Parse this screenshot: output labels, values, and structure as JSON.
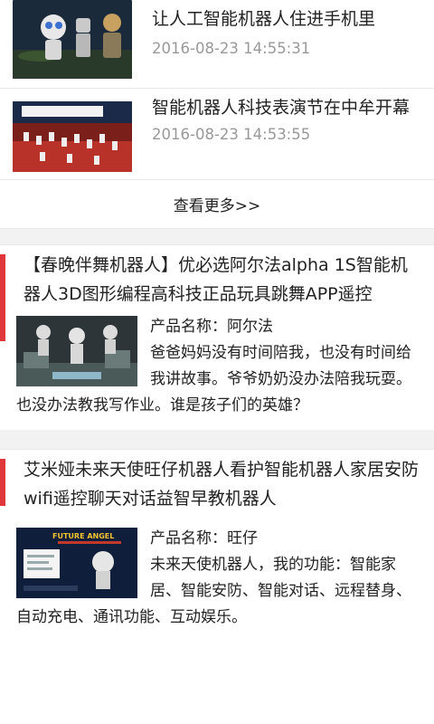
{
  "news": [
    {
      "title": "让人工智能机器人住进手机里",
      "date": "2016-08-23 14:55:31"
    },
    {
      "title": "智能机器人科技表演节在中牟开幕",
      "date": "2016-08-23 14:53:55"
    }
  ],
  "more_label": "查看更多>>",
  "products": [
    {
      "title": "【春晚伴舞机器人】优必选阿尔法alpha 1S智能机器人3D图形编程高科技正品玩具跳舞APP遥控",
      "name": "产品名称：阿尔法",
      "desc": "爸爸妈妈没有时间陪我，也没有时间给我讲故事。爷爷奶奶没办法陪我玩耍。也没办法教我写作业。谁是孩子们的英雄？"
    },
    {
      "title": "艾米娅未来天使旺仔机器人看护智能机器人家居安防wifi遥控聊天对话益智早教机器人",
      "name": "产品名称：旺仔",
      "desc": "未来天使机器人，我的功能：智能家居、智能安防、智能对话、远程替身、自动充电、通讯功能、互动娱乐。",
      "banner_text": "FUTURE ANGEL"
    }
  ],
  "colors": {
    "accent": "#e0373a",
    "date": "#999999",
    "divider": "#f2f2f2"
  }
}
